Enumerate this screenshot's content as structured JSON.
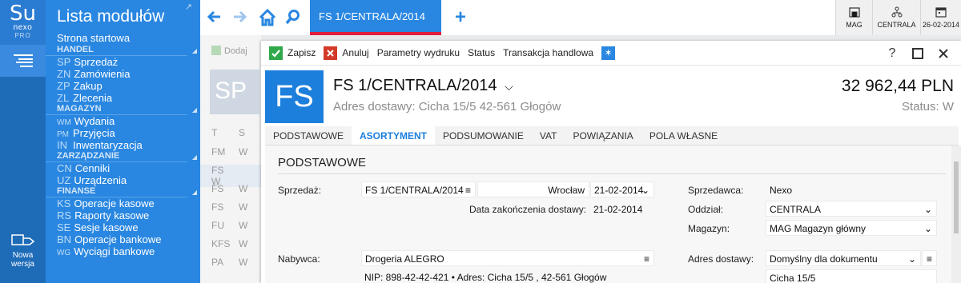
{
  "brand": {
    "line1": "Su",
    "line2": "nexo",
    "line3": "PRO"
  },
  "rail": {
    "new_window_label_1": "Nowa",
    "new_window_label_2": "wersja"
  },
  "modules": {
    "title": "Lista modułów",
    "start": "Strona startowa",
    "sections": [
      {
        "name": "HANDEL",
        "items": [
          {
            "code": "SP",
            "label": "Sprzedaż"
          },
          {
            "code": "ZN",
            "label": "Zamówienia"
          },
          {
            "code": "ZP",
            "label": "Zakup"
          },
          {
            "code": "ZL",
            "label": "Zlecenia"
          }
        ]
      },
      {
        "name": "MAGAZYN",
        "items": [
          {
            "code": "WM",
            "label": "Wydania"
          },
          {
            "code": "PM",
            "label": "Przyjęcia"
          },
          {
            "code": "IN",
            "label": "Inwentaryzacja"
          }
        ]
      },
      {
        "name": "ZARZĄDZANIE",
        "items": [
          {
            "code": "CN",
            "label": "Cenniki"
          },
          {
            "code": "UZ",
            "label": "Urządzenia"
          }
        ]
      },
      {
        "name": "FINANSE",
        "items": [
          {
            "code": "KS",
            "label": "Operacje kasowe"
          },
          {
            "code": "RS",
            "label": "Raporty kasowe"
          },
          {
            "code": "SE",
            "label": "Sesje kasowe"
          },
          {
            "code": "BN",
            "label": "Operacje bankowe"
          },
          {
            "code": "WG",
            "label": "Wyciągi bankowe"
          }
        ]
      }
    ]
  },
  "topbar": {
    "active_tab": "FS 1/CENTRALA/2014",
    "status": [
      {
        "label": "MAG",
        "icon": "warehouse-icon"
      },
      {
        "label": "CENTRALA",
        "icon": "org-tree-icon"
      },
      {
        "label": "26-02-2014",
        "icon": "calendar-icon"
      }
    ]
  },
  "background": {
    "toolbar_text": "Dodaj",
    "tile": "SP",
    "col1": "T",
    "col2": "S",
    "rows": [
      {
        "a": "FM",
        "b": "W"
      },
      {
        "a": "FS",
        "b": "W"
      },
      {
        "a": "FS",
        "b": "W"
      },
      {
        "a": "FS",
        "b": "W"
      },
      {
        "a": "FU",
        "b": "W"
      },
      {
        "a": "KFS",
        "b": "W"
      },
      {
        "a": "PA",
        "b": "W"
      }
    ]
  },
  "toolbar": {
    "save": "Zapisz",
    "cancel": "Anuluj",
    "print_params": "Parametry wydruku",
    "status": "Status",
    "transaction": "Transakcja handlowa",
    "help": "?"
  },
  "document": {
    "type_badge": "FS",
    "number": "FS 1/CENTRALA/2014",
    "address": "Adres dostawy: Cicha  15/5  42-561  Głogów",
    "amount": "32 962,44 PLN",
    "status": "Status: W"
  },
  "tabs": [
    "PODSTAWOWE",
    "ASORTYMENT",
    "PODSUMOWANIE",
    "VAT",
    "POWIĄZANIA",
    "POLA WŁASNE"
  ],
  "active_tab_index": 1,
  "form": {
    "section_title": "PODSTAWOWE",
    "sale_label": "Sprzedaż:",
    "sale_value": "FS 1/CENTRALA/2014",
    "city": "Wrocław",
    "sale_date": "21-02-2014",
    "delivery_end_label": "Data zakończenia dostawy:",
    "delivery_end_value": "21-02-2014",
    "seller_label": "Sprzedawca:",
    "seller_value": "Nexo",
    "branch_label": "Oddział:",
    "branch_value": "CENTRALA",
    "warehouse_label": "Magazyn:",
    "warehouse_value": "MAG  Magazyn główny",
    "buyer_label": "Nabywca:",
    "buyer_value": "Drogeria ALEGRO",
    "buyer_details": "NIP:  898-42-42-421  •  Adres:  Cicha  15/5 , 42-561  Głogów",
    "delivery_addr_label": "Adres dostawy:",
    "delivery_addr_value": "Domyślny dla dokumentu",
    "delivery_addr_line": "Cicha  15/5"
  },
  "colors": {
    "primary": "#2a87e1",
    "dark": "#1e6bb8",
    "accent_red": "#e0203a",
    "save_green": "#2ea84a",
    "cancel_red": "#d43a2a"
  }
}
